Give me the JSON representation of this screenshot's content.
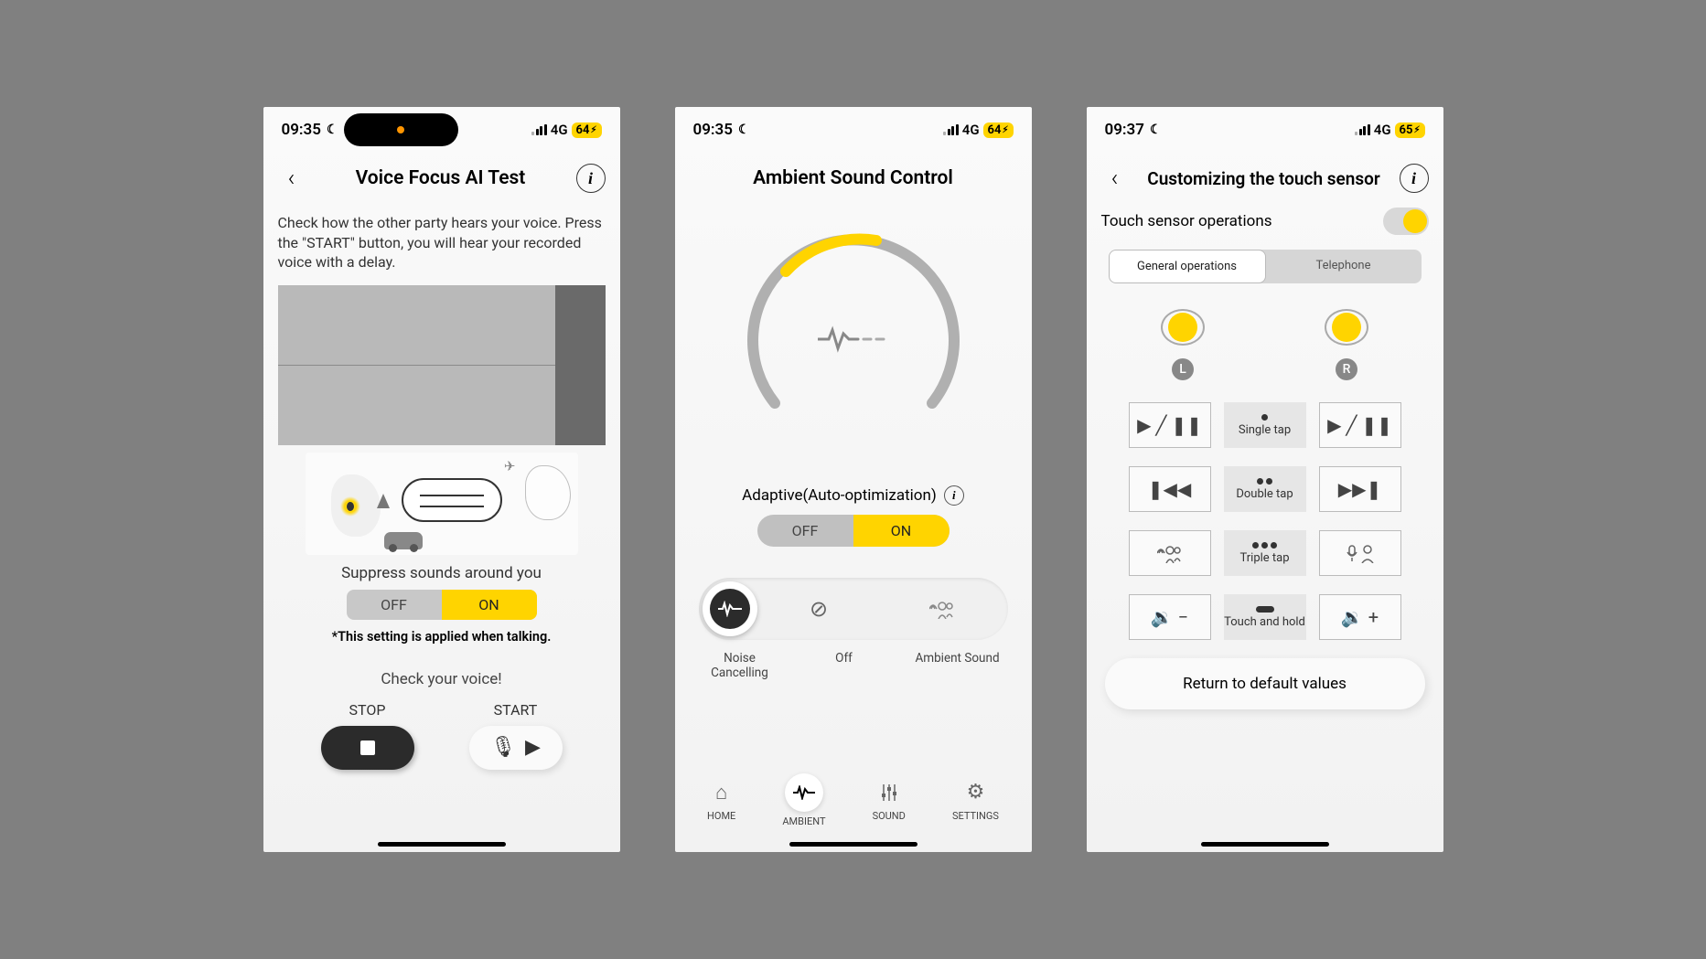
{
  "screen1": {
    "status": {
      "time": "09:35",
      "network": "4G",
      "battery": "64"
    },
    "title": "Voice Focus AI Test",
    "intro": "Check how the other party hears your voice. Press the \"START\" button, you will hear your recorded voice with a delay.",
    "suppress_label": "Suppress sounds around you",
    "toggle": {
      "off": "OFF",
      "on": "ON"
    },
    "note": "*This setting is applied when talking.",
    "check_voice": "Check your voice!",
    "stop_label": "STOP",
    "start_label": "START"
  },
  "screen2": {
    "status": {
      "time": "09:35",
      "network": "4G",
      "battery": "64"
    },
    "title": "Ambient Sound Control",
    "adaptive_label": "Adaptive(Auto-optimization)",
    "toggle": {
      "off": "OFF",
      "on": "ON"
    },
    "modes": {
      "nc": "Noise Cancelling",
      "off": "Off",
      "amb": "Ambient Sound"
    },
    "nav": {
      "home": "HOME",
      "ambient": "AMBIENT",
      "sound": "SOUND",
      "settings": "SETTINGS"
    }
  },
  "screen3": {
    "status": {
      "time": "09:37",
      "network": "4G",
      "battery": "65"
    },
    "title": "Customizing the touch sensor",
    "touch_label": "Touch sensor operations",
    "tabs": {
      "general": "General operations",
      "telephone": "Telephone"
    },
    "side": {
      "left": "L",
      "right": "R"
    },
    "gestures": {
      "single": "Single tap",
      "double": "Double tap",
      "triple": "Triple tap",
      "hold": "Touch and hold"
    },
    "default_btn": "Return to default values"
  }
}
